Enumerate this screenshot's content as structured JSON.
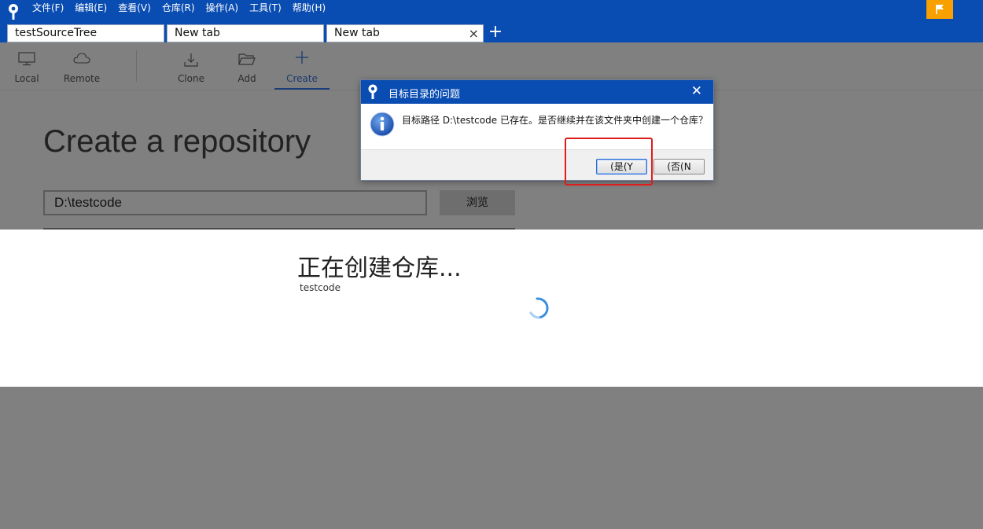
{
  "menu": [
    "文件(F)",
    "编辑(E)",
    "查看(V)",
    "仓库(R)",
    "操作(A)",
    "工具(T)",
    "帮助(H)"
  ],
  "tabs": [
    "testSourceTree",
    "New tab",
    "New tab"
  ],
  "new_tab_symbol": "+",
  "toolbar": {
    "local": "Local",
    "remote": "Remote",
    "clone": "Clone",
    "add": "Add",
    "create": "Create"
  },
  "create_page": {
    "title": "Create a repository",
    "path_value": "D:\\testcode",
    "browse_label": "浏览"
  },
  "progress": {
    "title": "正在创建仓库...",
    "repo_name": "testcode"
  },
  "dialog": {
    "title": "目标目录的问题",
    "message": "目标路径 D:\\testcode 已存在。是否继续并在该文件夹中创建一个仓库？",
    "yes_label": "(是(Y",
    "no_label": "(否(N",
    "close_symbol": "✕"
  },
  "colors": {
    "brand_blue": "#0a4db2",
    "flag_orange": "#f7a000",
    "highlight_red": "#e01b1b",
    "overlay_gray": "#808080"
  },
  "icons": [
    "sourcetree-logo-icon",
    "flag-icon",
    "close-icon",
    "monitor-icon",
    "cloud-icon",
    "download-icon",
    "folder-icon",
    "plus-icon",
    "info-icon",
    "spinner-icon"
  ]
}
